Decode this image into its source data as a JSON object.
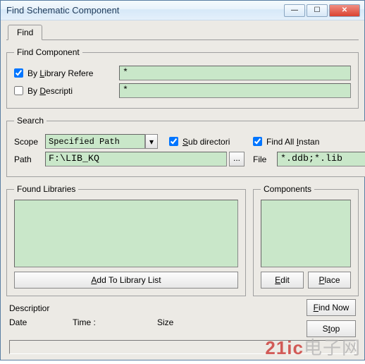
{
  "window": {
    "title": "Find Schematic Component"
  },
  "tabs": {
    "find": "Find"
  },
  "findComponent": {
    "legend": "Find Component",
    "byLibRef": {
      "checked": true,
      "label": "By Library Refere",
      "value": "*"
    },
    "byDesc": {
      "checked": false,
      "label": "By Descripti",
      "value": "*"
    }
  },
  "search": {
    "legend": "Search",
    "scopeLabel": "Scope",
    "scopeValue": "Specified Path",
    "subDir": {
      "checked": true,
      "label": "Sub directori"
    },
    "findAll": {
      "checked": true,
      "label": "Find All Instan"
    },
    "pathLabel": "Path",
    "pathValue": "F:\\LIB_KQ",
    "fileLabel": "File",
    "fileValue": "*.ddb;*.lib",
    "browseBtn": "..."
  },
  "found": {
    "libLegend": "Found Libraries",
    "compLegend": "Components",
    "addBtn": "Add To Library List",
    "editBtn": "Edit",
    "placeBtn": "Place"
  },
  "status": {
    "descLabel": "Descriptior",
    "dateLabel": "Date",
    "timeLabel": "Time :",
    "sizeLabel": "Size",
    "findNowBtn": "Find Now",
    "stopBtn": "Stop"
  },
  "watermark": {
    "brand": "21ic",
    "cn": "电子网"
  }
}
